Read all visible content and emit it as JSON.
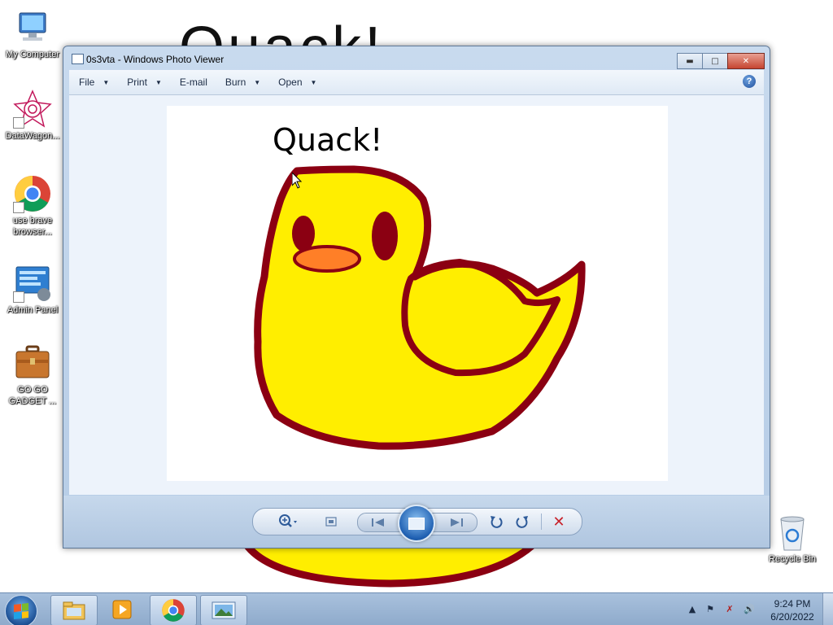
{
  "desktop": {
    "icons": [
      {
        "label": "My Computer",
        "icon": "computer-icon"
      },
      {
        "label": "DataWagon...",
        "icon": "datawagon-icon"
      },
      {
        "label": "use brave browser...",
        "icon": "chrome-icon"
      },
      {
        "label": "Admin Panel",
        "icon": "admin-panel-icon"
      },
      {
        "label": "GO GO GADGET ...",
        "icon": "briefcase-icon"
      }
    ],
    "recycle_bin": {
      "label": "Recycle Bin",
      "icon": "recycle-bin-icon"
    }
  },
  "window": {
    "title": "0s3vta - Windows Photo Viewer",
    "menu": [
      {
        "label": "File",
        "has_dropdown": true
      },
      {
        "label": "Print",
        "has_dropdown": true
      },
      {
        "label": "E-mail",
        "has_dropdown": false
      },
      {
        "label": "Burn",
        "has_dropdown": true
      },
      {
        "label": "Open",
        "has_dropdown": true
      }
    ],
    "help_label": "?",
    "photo": {
      "caption": "Quack!",
      "colors": {
        "body": "#ffee00",
        "outline": "#8b0012",
        "beak": "#ff7f27",
        "eye": "#8b0012"
      }
    },
    "controls": {
      "zoom": "zoom-icon",
      "fit": "actual-size-icon",
      "previous": "previous-icon",
      "slideshow": "slideshow-icon",
      "next": "next-icon",
      "rotate_ccw": "rotate-counterclockwise-icon",
      "rotate_cw": "rotate-clockwise-icon",
      "delete": "delete-icon"
    }
  },
  "taskbar": {
    "pinned": [
      "explorer-icon",
      "media-player-icon",
      "chrome-icon",
      "photo-viewer-icon"
    ],
    "clock": {
      "time": "9:24 PM",
      "date": "6/20/2022"
    }
  }
}
